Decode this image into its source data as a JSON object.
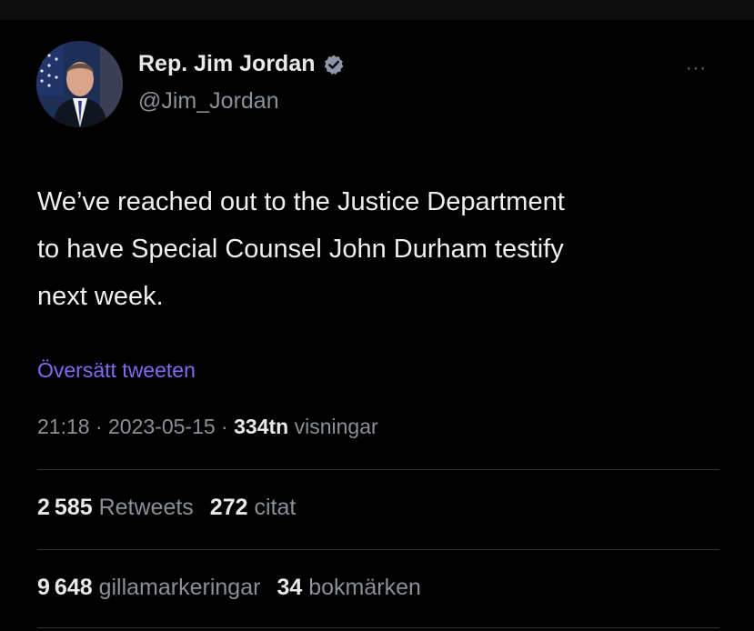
{
  "tweet": {
    "author": {
      "display_name": "Rep. Jim Jordan",
      "handle": "@Jim_Jordan",
      "verified": true,
      "verified_color": "#8b96a8",
      "avatar_icon": "profile-photo"
    },
    "more_label": "···",
    "text_lines": [
      "We’ve reached out to the Justice Department",
      "to have Special Counsel John Durham testify",
      "next week."
    ],
    "translate_label": "Översätt tweeten",
    "meta": {
      "time": "21:18",
      "sep1": " · ",
      "date": "2023-05-15",
      "sep2": " · ",
      "views_count": "334tn",
      "views_label": " visningar"
    },
    "stats": {
      "retweets_count": "2 585",
      "retweets_label": "Retweets",
      "quotes_count": "272",
      "quotes_label": "citat",
      "likes_count": "9 648",
      "likes_label": "gillamarkeringar",
      "bookmarks_count": "34",
      "bookmarks_label": "bokmärken"
    }
  },
  "colors": {
    "background": "#000000",
    "link": "#7d6cf0",
    "secondary_text": "#8b9096",
    "primary_text": "#e7e9ea"
  }
}
